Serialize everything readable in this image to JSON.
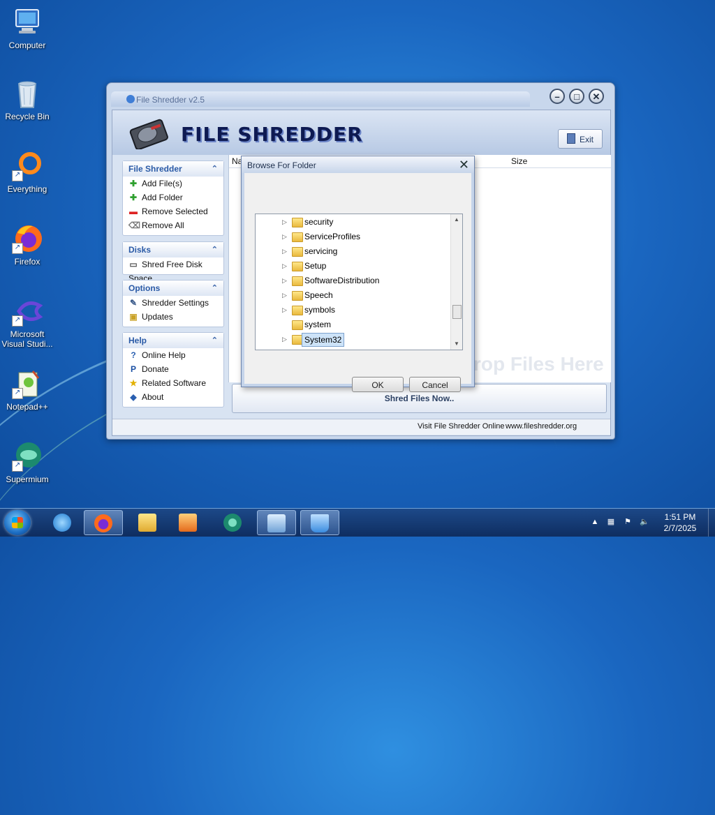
{
  "desktop": {
    "icons": [
      {
        "label": "Computer",
        "icon": "computer-icon"
      },
      {
        "label": "Recycle Bin",
        "icon": "recycle-bin-icon"
      },
      {
        "label": "Everything",
        "icon": "everything-icon"
      },
      {
        "label": "Firefox",
        "icon": "firefox-icon"
      },
      {
        "label": "Microsoft Visual Studi...",
        "icon": "visual-studio-icon"
      },
      {
        "label": "Notepad++",
        "icon": "notepadpp-icon"
      },
      {
        "label": "Supermium",
        "icon": "supermium-icon"
      }
    ]
  },
  "app": {
    "title": "File Shredder v2.5",
    "logo_text": "FILE SHREDDER",
    "exit_label": "Exit",
    "panels": {
      "file_shredder": {
        "title": "File Shredder",
        "items": [
          "Add File(s)",
          "Add Folder",
          "Remove Selected",
          "Remove All"
        ]
      },
      "disks": {
        "title": "Disks",
        "items": [
          "Shred Free Disk Space"
        ]
      },
      "options": {
        "title": "Options",
        "items": [
          "Shredder Settings",
          "Updates"
        ]
      },
      "help": {
        "title": "Help",
        "items": [
          "Online Help",
          "Donate",
          "Related Software",
          "About"
        ]
      }
    },
    "list_columns": {
      "name": "Na",
      "size": "Size"
    },
    "drop_hint": "rop Files Here",
    "shred_button": "Shred Files Now..",
    "status": {
      "visit": "Visit File Shredder Online",
      "url": "www.fileshredder.org"
    }
  },
  "dialog": {
    "title": "Browse For Folder",
    "folders": [
      {
        "name": "security",
        "expandable": true
      },
      {
        "name": "ServiceProfiles",
        "expandable": true
      },
      {
        "name": "servicing",
        "expandable": true
      },
      {
        "name": "Setup",
        "expandable": true
      },
      {
        "name": "SoftwareDistribution",
        "expandable": true
      },
      {
        "name": "Speech",
        "expandable": true
      },
      {
        "name": "symbols",
        "expandable": true
      },
      {
        "name": "system",
        "expandable": false
      },
      {
        "name": "System32",
        "expandable": true,
        "selected": true
      }
    ],
    "ok_label": "OK",
    "cancel_label": "Cancel"
  },
  "taskbar": {
    "clock_time": "1:51 PM",
    "clock_date": "2/7/2025"
  }
}
